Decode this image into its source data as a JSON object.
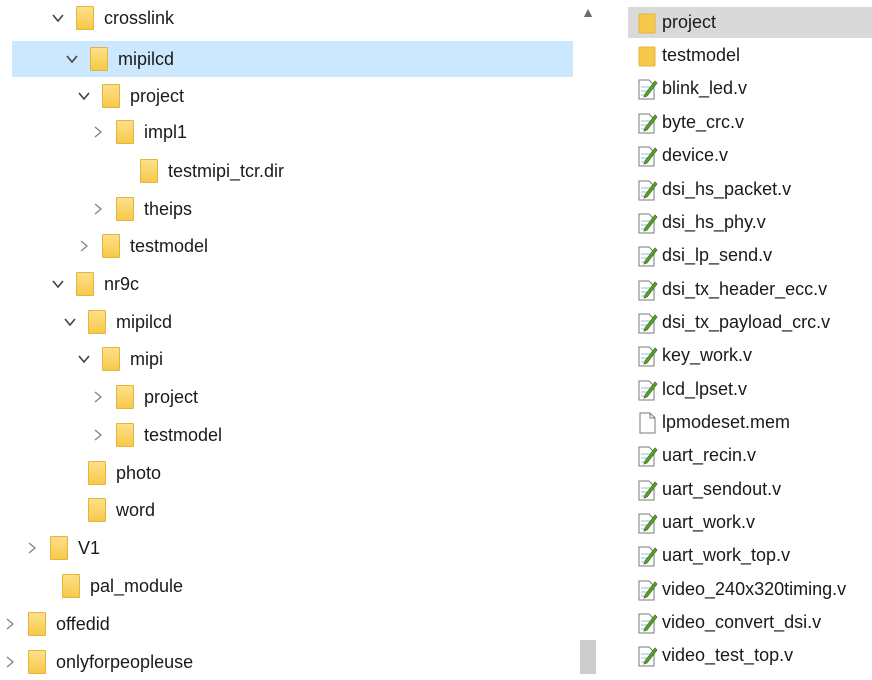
{
  "nav_tree": [
    {
      "label": "crosslink",
      "expanded": true
    },
    {
      "label": "mipilcd",
      "expanded": true,
      "selected": true
    },
    {
      "label": "project",
      "expanded": true
    },
    {
      "label": "impl1",
      "expanded": false
    },
    {
      "label": "testmipi_tcr.dir"
    },
    {
      "label": "theips",
      "expanded": false
    },
    {
      "label": "testmodel",
      "expanded": false
    },
    {
      "label": "nr9c",
      "expanded": true
    },
    {
      "label": "mipilcd",
      "expanded": true
    },
    {
      "label": "mipi",
      "expanded": true
    },
    {
      "label": "project",
      "expanded": false
    },
    {
      "label": "testmodel",
      "expanded": false
    },
    {
      "label": "photo"
    },
    {
      "label": "word"
    },
    {
      "label": "V1",
      "expanded": false
    },
    {
      "label": "pal_module"
    },
    {
      "label": "offedid",
      "expanded": false
    },
    {
      "label": "onlyforpeopleuse",
      "expanded": false
    }
  ],
  "files": [
    {
      "name": "project",
      "icon": "folder-icon",
      "selected": true
    },
    {
      "name": "testmodel",
      "icon": "folder-icon"
    },
    {
      "name": "blink_led.v",
      "icon": "verilog-file-icon"
    },
    {
      "name": "byte_crc.v",
      "icon": "verilog-file-icon"
    },
    {
      "name": "device.v",
      "icon": "verilog-file-icon"
    },
    {
      "name": "dsi_hs_packet.v",
      "icon": "verilog-file-icon"
    },
    {
      "name": "dsi_hs_phy.v",
      "icon": "verilog-file-icon"
    },
    {
      "name": "dsi_lp_send.v",
      "icon": "verilog-file-icon"
    },
    {
      "name": "dsi_tx_header_ecc.v",
      "icon": "verilog-file-icon"
    },
    {
      "name": "dsi_tx_payload_crc.v",
      "icon": "verilog-file-icon"
    },
    {
      "name": "key_work.v",
      "icon": "verilog-file-icon"
    },
    {
      "name": "lcd_lpset.v",
      "icon": "verilog-file-icon"
    },
    {
      "name": "lpmodeset.mem",
      "icon": "blank-file-icon"
    },
    {
      "name": "uart_recin.v",
      "icon": "verilog-file-icon"
    },
    {
      "name": "uart_sendout.v",
      "icon": "verilog-file-icon"
    },
    {
      "name": "uart_work.v",
      "icon": "verilog-file-icon"
    },
    {
      "name": "uart_work_top.v",
      "icon": "verilog-file-icon"
    },
    {
      "name": "video_240x320timing.v",
      "icon": "verilog-file-icon"
    },
    {
      "name": "video_convert_dsi.v",
      "icon": "verilog-file-icon"
    },
    {
      "name": "video_test_top.v",
      "icon": "verilog-file-icon"
    }
  ],
  "colors": {
    "selection": "#cce8ff",
    "folder": "#f7c94a",
    "file_selection": "#d9d9d9"
  }
}
